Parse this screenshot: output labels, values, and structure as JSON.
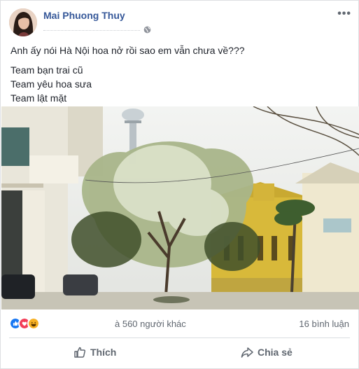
{
  "post": {
    "author": "Mai Phuong Thuy",
    "lines": [
      "Anh ấy nói Hà Nội hoa nở rồi sao em vẫn chưa về???",
      "Team bạn trai cũ",
      "Team yêu hoa sưa",
      "Team lật mặt"
    ]
  },
  "stats": {
    "reactions_text": "à 560 người khác",
    "comments_text": "16 bình luận"
  },
  "actions": {
    "like_label": "Thích",
    "share_label": "Chia sẻ"
  },
  "colors": {
    "author_link": "#365899",
    "like_reaction": "#1877f2",
    "love_reaction": "#f33e58",
    "haha_reaction": "#f7b125"
  },
  "icons": [
    "globe-icon",
    "more-options-icon",
    "like-reaction-icon",
    "love-reaction-icon",
    "haha-reaction-icon",
    "thumbs-up-icon",
    "share-arrow-icon"
  ]
}
